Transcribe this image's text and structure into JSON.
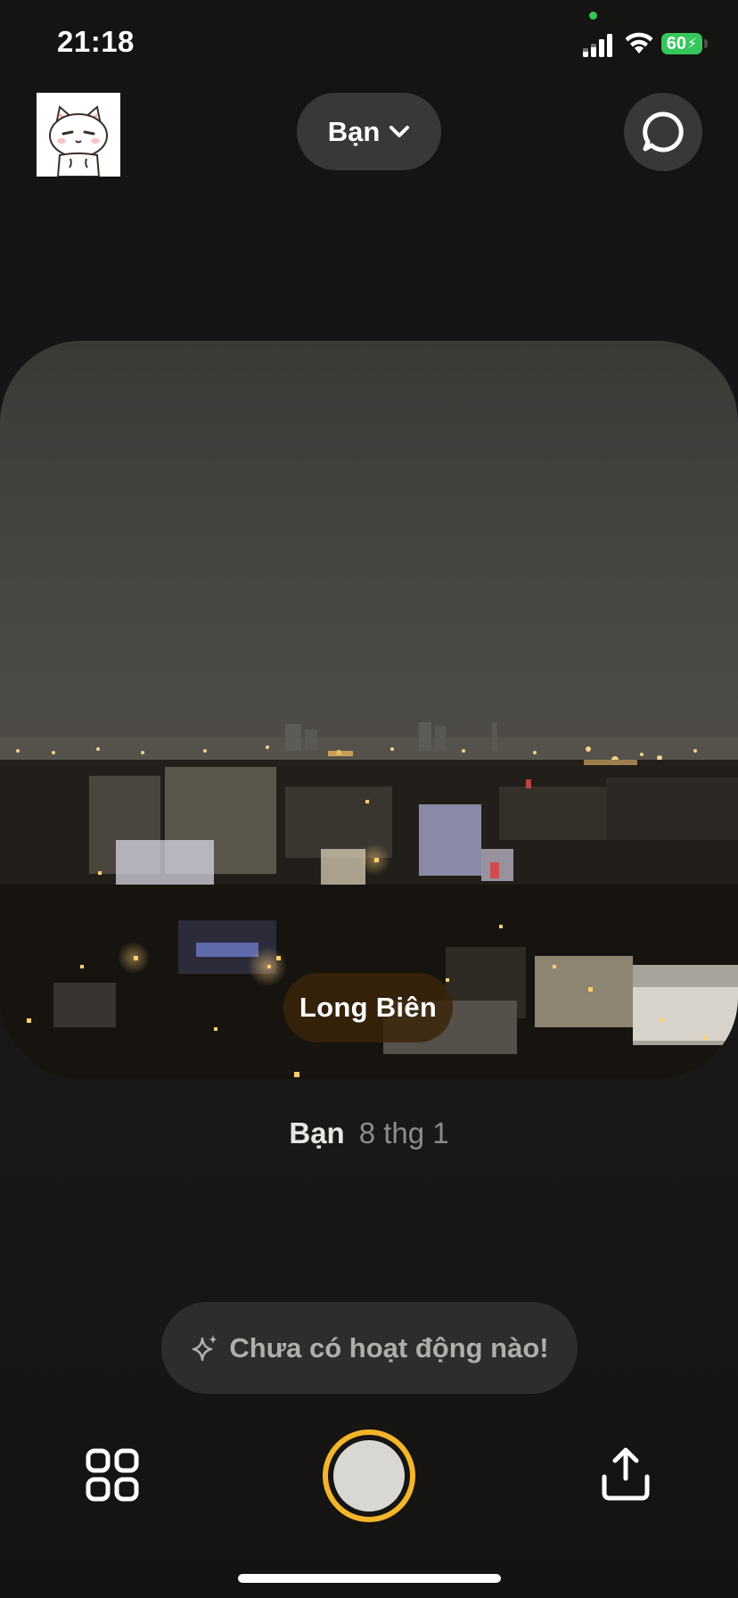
{
  "status_bar": {
    "time": "21:18",
    "battery": "60",
    "icons": [
      "signal-icon",
      "wifi-icon",
      "battery-charging-icon"
    ],
    "mic_indicator_color": "#34c759"
  },
  "header": {
    "avatar_icon": "cat-sticker-avatar",
    "friends_selector_label": "Bạn",
    "friends_selector_icon": "chevron-down-icon",
    "chat_icon": "chat-bubble-icon"
  },
  "photo": {
    "location": "Long Biên"
  },
  "caption": {
    "name": "Bạn",
    "date": "8 thg 1"
  },
  "activity": {
    "icon": "sparkle-icon",
    "text": "Chưa có hoạt động nào!"
  },
  "bottom_bar": {
    "left_icon": "grid-icon",
    "center": "shutter-button",
    "right_icon": "share-icon"
  },
  "colors": {
    "background": "#151413",
    "pill": "#3a3836",
    "shutter_ring": "#f5b52a",
    "battery": "#34c759"
  }
}
